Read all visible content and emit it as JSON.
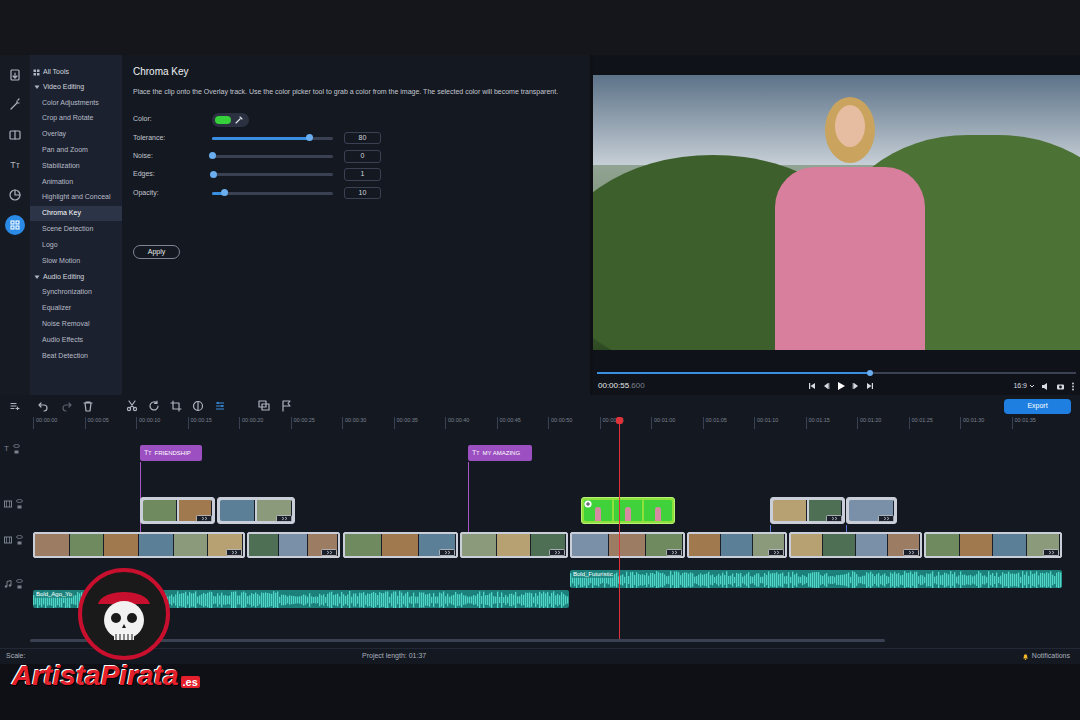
{
  "rail": [
    {
      "selected": false
    },
    {
      "selected": false
    },
    {
      "selected": false
    },
    {
      "selected": false,
      "glyph": "Tт"
    },
    {
      "selected": false
    },
    {
      "selected": true
    }
  ],
  "sidebar": {
    "title": "All Tools",
    "sections": [
      {
        "label": "Video Editing",
        "expanded": true,
        "items": [
          {
            "label": "Color Adjustments",
            "selected": false
          },
          {
            "label": "Crop and Rotate",
            "selected": false
          },
          {
            "label": "Overlay",
            "selected": false
          },
          {
            "label": "Pan and Zoom",
            "selected": false
          },
          {
            "label": "Stabilization",
            "selected": false
          },
          {
            "label": "Animation",
            "selected": false
          },
          {
            "label": "Highlight and Conceal",
            "selected": false
          },
          {
            "label": "Chroma Key",
            "selected": true
          },
          {
            "label": "Scene Detection",
            "selected": false
          },
          {
            "label": "Logo",
            "selected": false
          },
          {
            "label": "Slow Motion",
            "selected": false
          }
        ]
      },
      {
        "label": "Audio Editing",
        "expanded": true,
        "items": [
          {
            "label": "Synchronization",
            "selected": false
          },
          {
            "label": "Equalizer",
            "selected": false
          },
          {
            "label": "Noise Removal",
            "selected": false
          },
          {
            "label": "Audio Effects",
            "selected": false
          },
          {
            "label": "Beat Detection",
            "selected": false
          }
        ]
      }
    ]
  },
  "panel": {
    "title": "Chroma Key",
    "description": "Place the clip onto the Overlay track. Use the color picker tool to grab a color from the image. The selected color will become transparent.",
    "color": {
      "label": "Color:",
      "value": "#35d03a"
    },
    "sliders": [
      {
        "label": "Tolerance:",
        "value": "80",
        "level": 0.8
      },
      {
        "label": "Noise:",
        "value": "0",
        "level": 0
      },
      {
        "label": "Edges:",
        "value": "1",
        "level": 0.01
      },
      {
        "label": "Opacity:",
        "value": "10",
        "level": 0.1
      }
    ],
    "apply": "Apply"
  },
  "preview": {
    "time": "00:00:55",
    "time_fraction": ".600",
    "progress": 0.57,
    "aspect": "16:9"
  },
  "timeline": {
    "export": "Export",
    "ruler": [
      "00:00:00",
      "00:00:05",
      "00:00:10",
      "00:00:15",
      "00:00:20",
      "00:00:25",
      "00:00:30",
      "00:00:35",
      "00:00:40",
      "00:00:45",
      "00:00:50",
      "00:00:55",
      "00:01:00",
      "00:01:05",
      "00:01:10",
      "00:01:15",
      "00:01:20",
      "00:01:25",
      "00:01:30",
      "00:01:35"
    ],
    "text_track_glyph": "T",
    "text_clips": [
      {
        "icon": "Tт",
        "label": "FRIENDSHIP"
      },
      {
        "icon": "Tт",
        "label": "MY AMAZING"
      }
    ],
    "overlay_clips": [
      {
        "selected": false
      },
      {
        "selected": false
      },
      {
        "selected": true
      },
      {
        "selected": false
      },
      {
        "selected": false
      }
    ],
    "audio_clips": [
      {
        "label": "Bold_Ago_Yo"
      },
      {
        "label": "Bold_Futuristic"
      }
    ]
  },
  "status_bar": {
    "scale": "Scale:",
    "project_length": "Project length: 01:37",
    "notifications": "Notifications"
  },
  "watermark": {
    "text": "ArtistaPirata",
    "suffix": ".es"
  }
}
